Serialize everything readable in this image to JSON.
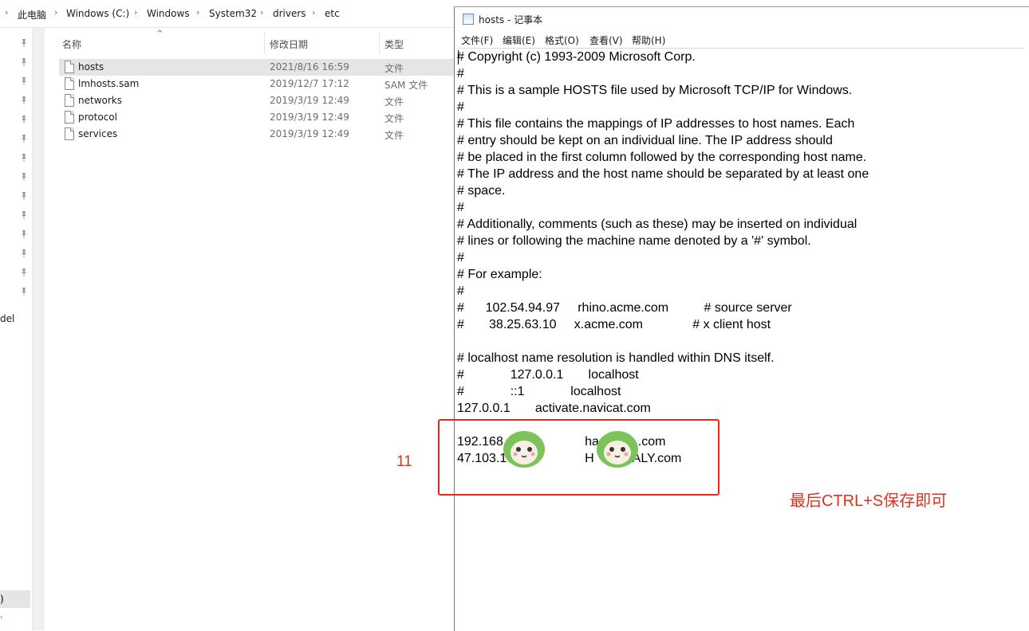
{
  "explorer": {
    "breadcrumb": [
      "此电脑",
      "Windows (C:)",
      "Windows",
      "System32",
      "drivers",
      "etc"
    ],
    "columns": {
      "name": "名称",
      "modified": "修改日期",
      "type": "类型"
    },
    "files": [
      {
        "name": "hosts",
        "modified": "2021/8/16 16:59",
        "type": "文件",
        "selected": true
      },
      {
        "name": "lmhosts.sam",
        "modified": "2019/12/7 17:12",
        "type": "SAM 文件",
        "selected": false
      },
      {
        "name": "networks",
        "modified": "2019/3/19 12:49",
        "type": "文件",
        "selected": false
      },
      {
        "name": "protocol",
        "modified": "2019/3/19 12:49",
        "type": "文件",
        "selected": false
      },
      {
        "name": "services",
        "modified": "2019/3/19 12:49",
        "type": "文件",
        "selected": false
      }
    ],
    "nav_partial_label": "del",
    "nav_selected_partial": ")",
    "nav_cyan_partial": "'"
  },
  "notepad": {
    "title": "hosts - 记事本",
    "menu": [
      "文件(F)",
      "编辑(E)",
      "格式(O)",
      "查看(V)",
      "帮助(H)"
    ],
    "lines": [
      "# Copyright (c) 1993-2009 Microsoft Corp.",
      "#",
      "# This is a sample HOSTS file used by Microsoft TCP/IP for Windows.",
      "#",
      "# This file contains the mappings of IP addresses to host names. Each",
      "# entry should be kept on an individual line. The IP address should",
      "# be placed in the first column followed by the corresponding host name.",
      "# The IP address and the host name should be separated by at least one",
      "# space.",
      "#",
      "# Additionally, comments (such as these) may be inserted on individual",
      "# lines or following the machine name denoted by a '#' symbol.",
      "#",
      "# For example:",
      "#",
      "#      102.54.94.97     rhino.acme.com          # source server",
      "#       38.25.63.10     x.acme.com              # x client host",
      "",
      "# localhost name resolution is handled within DNS itself.",
      "#             127.0.0.1       localhost",
      "#             ::1             localhost",
      "127.0.0.1       activate.navicat.com",
      "",
      "192.168                       ha           .com",
      "47.103.1                      H           ALY.com"
    ]
  },
  "annotations": {
    "label_11": "11",
    "save_note": "最后CTRL+S保存即可",
    "highlight_color": "#e8281c"
  }
}
